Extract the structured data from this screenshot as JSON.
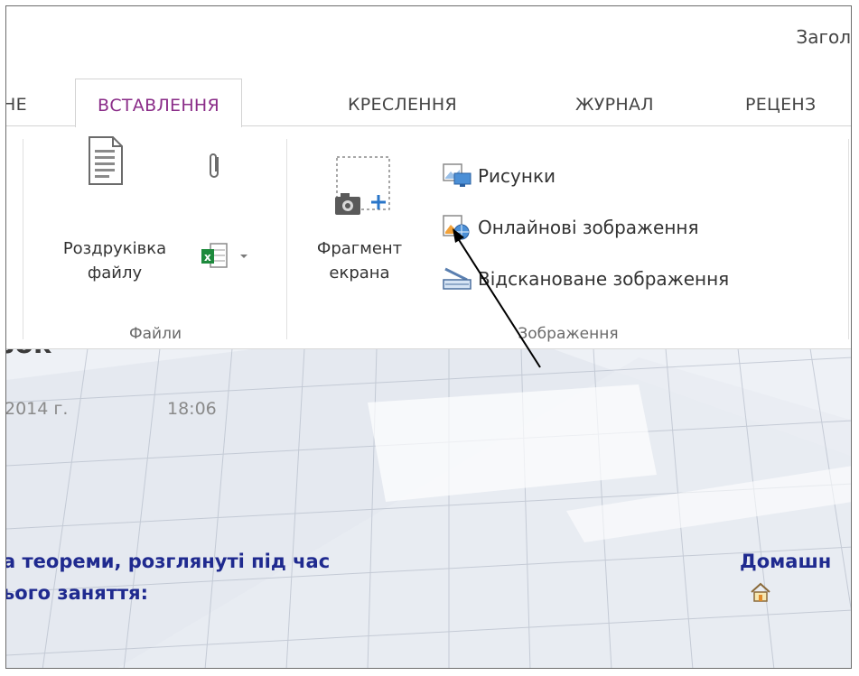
{
  "window": {
    "title": "Загол"
  },
  "tabs": [
    {
      "label": "НЕ"
    },
    {
      "label": "ВСТАВЛЕННЯ",
      "active": true
    },
    {
      "label": "КРЕСЛЕННЯ"
    },
    {
      "label": "ЖУРНАЛ"
    },
    {
      "label": "РЕЦЕНЗ"
    }
  ],
  "ribbon": {
    "files_group": {
      "label": "Файли",
      "printout_label_line1": "Роздруківка",
      "printout_label_line2": "файлу",
      "icons": [
        "document-icon",
        "paperclip-icon",
        "excel-spreadsheet-icon"
      ]
    },
    "images_group": {
      "label": "Зображення",
      "screen_clipping_line1": "Фрагмент",
      "screen_clipping_line2": "екрана",
      "pictures_label": "Рисунки",
      "online_pictures_label": "Онлайнові зображення",
      "scanned_image_label": "Відскановане зображення"
    }
  },
  "page": {
    "heading": "зок",
    "date": "2014 г.",
    "time": "18:06",
    "note_line1": "а теореми, розглянуті під час",
    "note_line2": "ього заняття:",
    "homework_label": "Домашн"
  },
  "colors": {
    "active_tab": "#8a2c88",
    "note_text": "#1f2a8f"
  }
}
